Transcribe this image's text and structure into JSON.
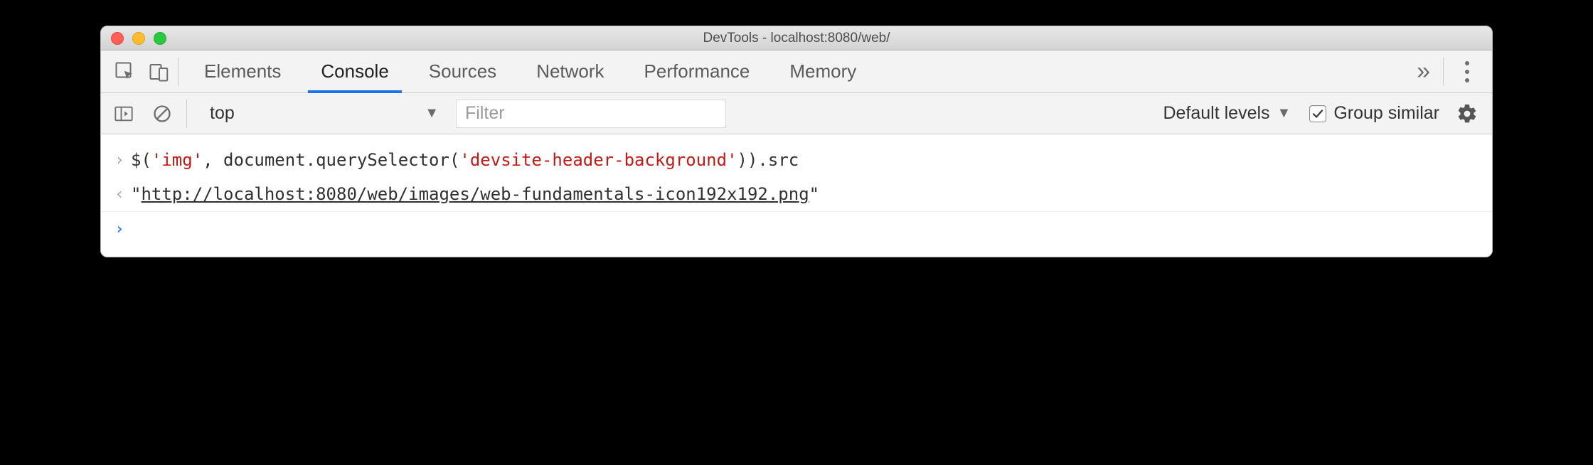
{
  "window": {
    "title": "DevTools - localhost:8080/web/"
  },
  "tabs": {
    "items": [
      "Elements",
      "Console",
      "Sources",
      "Network",
      "Performance",
      "Memory"
    ],
    "active_index": 1
  },
  "toolbar": {
    "context": "top",
    "filter_placeholder": "Filter",
    "levels_label": "Default levels",
    "group_similar_label": "Group similar",
    "group_similar_checked": true
  },
  "console": {
    "input_parts": {
      "p1": "$(",
      "s1": "'img'",
      "p2": ", document.querySelector(",
      "s2": "'devsite-header-background'",
      "p3": ")).src"
    },
    "output": {
      "q1": "\"",
      "url": "http://localhost:8080/web/images/web-fundamentals-icon192x192.png",
      "q2": "\""
    }
  }
}
